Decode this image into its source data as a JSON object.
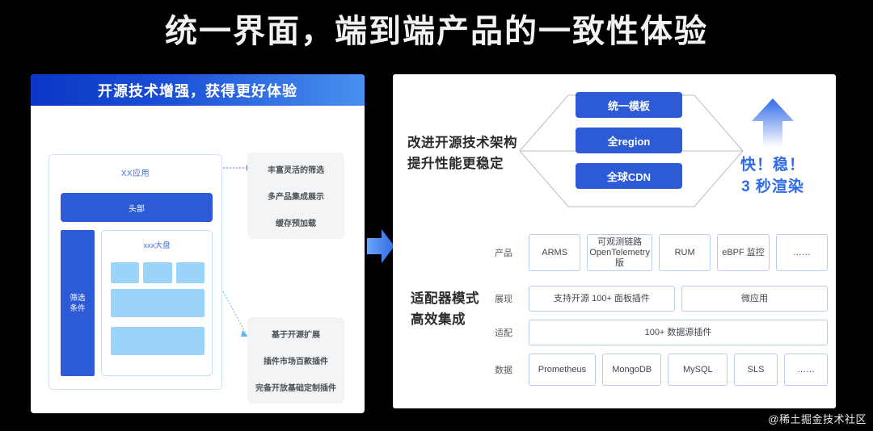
{
  "slide": {
    "title": "统一界面，端到端产品的一致性体验",
    "watermark": "@稀土掘金技术社区"
  },
  "colors": {
    "background": "#000000",
    "brand_blue": "#2d5bd7",
    "header_blue_dark": "#0b37c4",
    "header_blue_light": "#4a90f0",
    "accent_text_blue": "#2f6ae8",
    "light_blue_block": "#9bd4fb",
    "panel_white": "#ffffff",
    "feature_gray": "#f3f4f5"
  },
  "left_panel": {
    "header": "开源技术增强，获得更好体验",
    "app_mock": {
      "title": "XX应用",
      "header_bar": "头部",
      "filter_bar": "筛选\n条件",
      "filter_bar_line1": "筛选",
      "filter_bar_line2": "条件",
      "dashboard_title": "xxx大盘"
    },
    "feature_boxes": [
      {
        "name": "filter-features",
        "lines": [
          "丰富灵活的筛选",
          "多产品集成展示",
          "缓存预加载"
        ]
      },
      {
        "name": "plugin-features",
        "lines": [
          "基于开源扩展",
          "插件市场百款插件",
          "完备开放基础定制插件"
        ]
      }
    ]
  },
  "middle": {
    "arrow_icon": "arrow-right-icon"
  },
  "right_panel": {
    "architecture": {
      "label_line1": "改进开源技术架构",
      "label_line2": "提升性能更稳定",
      "boxes": [
        "统一模板",
        "全region",
        "全球CDN"
      ],
      "result": {
        "arrow_icon": "arrow-up-icon",
        "line1": "快！稳！",
        "line2": "3 秒渲染"
      }
    },
    "adapter": {
      "label_line1": "适配器模式",
      "label_line2": "高效集成",
      "rows": [
        {
          "label": "产品",
          "cells": [
            {
              "text": "ARMS",
              "flex": 1
            },
            {
              "text": "可观测链路OpenTelemetry版",
              "flex": 1
            },
            {
              "text": "RUM",
              "flex": 1
            },
            {
              "text": "eBPF 监控",
              "flex": 1
            },
            {
              "text": "……",
              "flex": 1
            }
          ]
        },
        {
          "label": "展现",
          "cells": [
            {
              "text": "支持开源 100+ 面板插件",
              "flex": 1
            },
            {
              "text": "微应用",
              "flex": 1
            }
          ]
        },
        {
          "label": "适配",
          "cells": [
            {
              "text": "100+ 数据源插件",
              "flex": 1
            }
          ]
        },
        {
          "label": "数据",
          "cells": [
            {
              "text": "Prometheus",
              "flex": 1.25
            },
            {
              "text": "MongoDB",
              "flex": 1.1
            },
            {
              "text": "MySQL",
              "flex": 1.1
            },
            {
              "text": "SLS",
              "flex": 0.78
            },
            {
              "text": "……",
              "flex": 0.78
            }
          ]
        }
      ]
    }
  }
}
